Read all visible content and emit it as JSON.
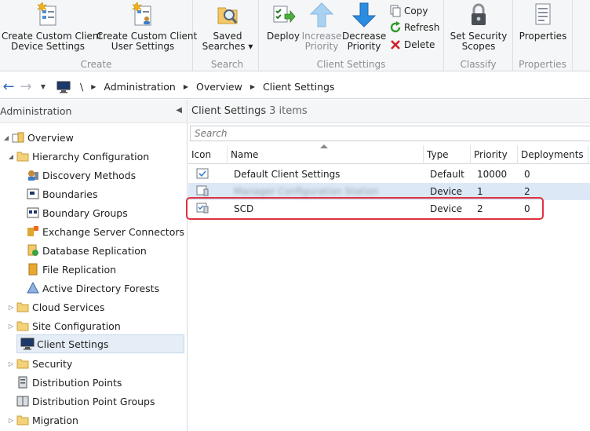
{
  "ribbon": {
    "groups": {
      "create": "Create",
      "search": "Search",
      "client_settings": "Client Settings",
      "classify": "Classify",
      "properties": "Properties"
    },
    "buttons": {
      "create_device": [
        "Create Custom Client",
        "Device Settings"
      ],
      "create_user": [
        "Create Custom Client",
        "User Settings"
      ],
      "saved_searches": [
        "Saved",
        "Searches ▾"
      ],
      "deploy": "Deploy",
      "increase_priority": [
        "Increase",
        "Priority"
      ],
      "decrease_priority": [
        "Decrease",
        "Priority"
      ],
      "copy": "Copy",
      "refresh": "Refresh",
      "delete": "Delete",
      "set_security_scopes": [
        "Set Security",
        "Scopes"
      ],
      "properties": "Properties"
    }
  },
  "address": {
    "root": "\\",
    "crumbs": [
      "Administration",
      "Overview",
      "Client Settings"
    ]
  },
  "leftpane": {
    "title": "Administration",
    "tree": [
      {
        "label": "Overview"
      },
      {
        "label": "Hierarchy Configuration"
      },
      {
        "label": "Discovery Methods"
      },
      {
        "label": "Boundaries"
      },
      {
        "label": "Boundary Groups"
      },
      {
        "label": "Exchange Server Connectors"
      },
      {
        "label": "Database Replication"
      },
      {
        "label": "File Replication"
      },
      {
        "label": "Active Directory Forests"
      },
      {
        "label": "Cloud Services"
      },
      {
        "label": "Site Configuration"
      },
      {
        "label": "Client Settings"
      },
      {
        "label": "Security"
      },
      {
        "label": "Distribution Points"
      },
      {
        "label": "Distribution Point Groups"
      },
      {
        "label": "Migration"
      }
    ]
  },
  "main": {
    "title": "Client Settings",
    "count": "3 items",
    "search_placeholder": "Search",
    "columns": [
      "Icon",
      "Name",
      "Type",
      "Priority",
      "Deployments"
    ],
    "rows": [
      {
        "name": "Default Client Settings",
        "type": "Default",
        "priority": "10000",
        "deployments": "0"
      },
      {
        "name": "Manager Configuration Station",
        "type": "Device",
        "priority": "1",
        "deployments": "2"
      },
      {
        "name": "SCD",
        "type": "Device",
        "priority": "2",
        "deployments": "0"
      }
    ]
  },
  "colors": {
    "accent": "#1f6fd1",
    "highlight": "#e0313f",
    "selected_row": "#dce8f6"
  }
}
